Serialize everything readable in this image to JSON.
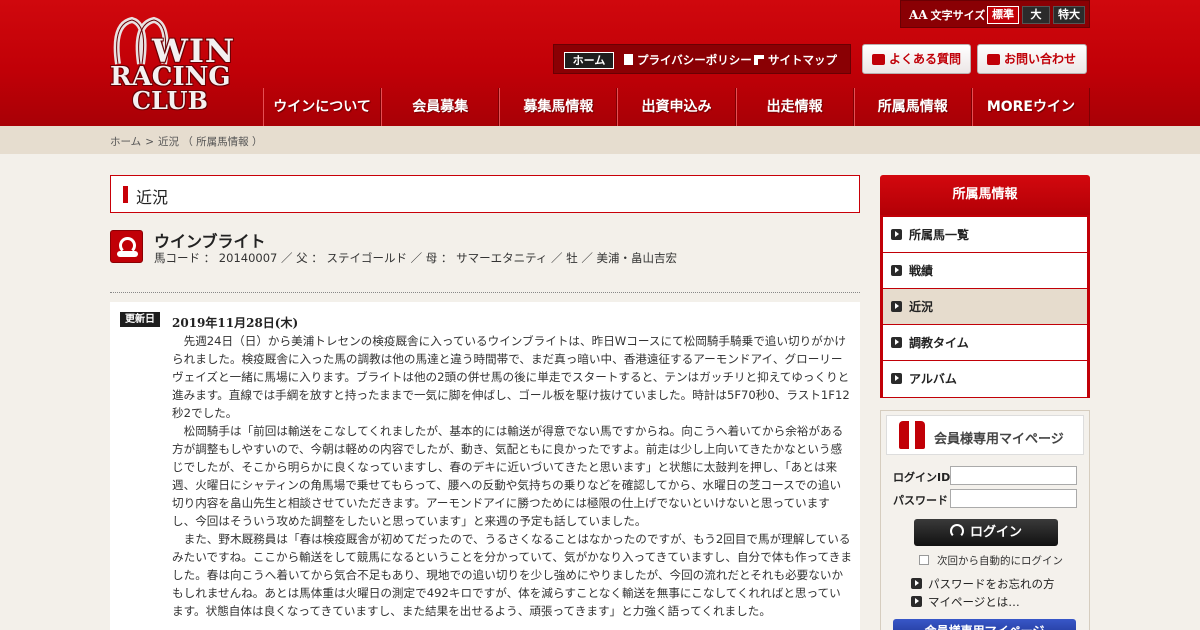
{
  "logo": {
    "line1": "WIN",
    "line2": "RACING",
    "line3": "CLUB"
  },
  "fontsize": {
    "label": "文字サイズ",
    "aa": "AA",
    "options": [
      "標準",
      "大",
      "特大"
    ]
  },
  "subnav": {
    "home": "ホーム",
    "privacy": "プライバシーポリシー",
    "sitemap": "サイトマップ"
  },
  "header_buttons": {
    "faq": "よくある質問",
    "contact": "お問い合わせ"
  },
  "gnav": [
    "ウインについて",
    "会員募集",
    "募集馬情報",
    "出資申込み",
    "出走情報",
    "所属馬情報",
    "MOREウイン"
  ],
  "breadcrumb": {
    "home": "ホーム",
    "sep": ">",
    "current": "近況",
    "paren": "（ 所属馬情報 ）"
  },
  "page_title": "近況",
  "horse": {
    "name": "ウインブライト",
    "info": "馬コード ： 20140007 ／ 父 ： ステイゴールド ／ 母 ： サマーエタニティ ／ 牡 ／ 美浦・畠山吉宏"
  },
  "news": {
    "badge": "更新日",
    "date": "2019年11月28日(木)",
    "paragraphs": [
      "先週24日（日）から美浦トレセンの検疫厩舎に入っているウインブライトは、昨日Wコースにて松岡騎手騎乗で追い切りがかけられました。検疫厩舎に入った馬の調教は他の馬達と違う時間帯で、まだ真っ暗い中、香港遠征するアーモンドアイ、グローリーヴェイズと一緒に馬場に入ります。ブライトは他の2頭の併せ馬の後に単走でスタートすると、テンはガッチリと抑えてゆっくりと進みます。直線では手綱を放すと持ったままで一気に脚を伸ばし、ゴール板を駆け抜けていました。時計は5F70秒0、ラスト1F12秒2でした。",
      "松岡騎手は「前回は輸送をこなしてくれましたが、基本的には輸送が得意でない馬ですからね。向こうへ着いてから余裕がある方が調整もしやすいので、今朝は軽めの内容でしたが、動き、気配ともに良かったですよ。前走は少し上向いてきたかなという感じでしたが、そこから明らかに良くなっていますし、春のデキに近いづいてきたと思います」と状態に太鼓判を押し、「あとは来週、火曜日にシャティンの角馬場で乗せてもらって、腰への反動や気持ちの乗りなどを確認してから、水曜日の芝コースでの追い切り内容を畠山先生と相談させていただきます。アーモンドアイに勝つためには極限の仕上げでないといけないと思っていますし、今回はそういう攻めた調整をしたいと思っています」と来週の予定も話していました。",
      "また、野木厩務員は「春は検疫厩舎が初めてだったので、うるさくなることはなかったのですが、もう2回目で馬が理解しているみたいですね。ここから輸送をして競馬になるということを分かっていて、気がかなり入ってきていますし、自分で体も作ってきました。春は向こうへ着いてから気合不足もあり、現地での追い切りを少し強めにやりましたが、今回の流れだとそれも必要ないかもしれませんね。あとは馬体重は火曜日の測定で492キロですが、体を減らすことなく輸送を無事にこなしてくれればと思っています。状態自体は良くなってきていますし、また結果を出せるよう、頑張ってきます」と力強く語ってくれました。"
    ]
  },
  "sidebar": {
    "title": "所属馬情報",
    "items": [
      "所属馬一覧",
      "戦績",
      "近況",
      "調教タイム",
      "アルバム"
    ],
    "active_index": 2
  },
  "login": {
    "title": "会員様専用マイページ",
    "id_label": "ログインID",
    "pw_label": "パスワード",
    "button": "ログイン",
    "auto_login": "次回から自動的にログイン",
    "forgot": "パスワードをお忘れの方",
    "about": "マイページとは…",
    "mypage_button": "会員様専用マイページ"
  },
  "colors": {
    "brand_red": "#c10007",
    "dark": "#1e1e1e",
    "beige": "#e6ddcf"
  }
}
